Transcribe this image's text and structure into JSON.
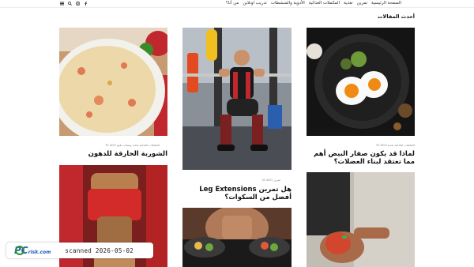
{
  "nav": {
    "items": [
      "الصفحة الرئيسية",
      "تمرين",
      "تغذية",
      "المكملات الغذائية",
      "الأدوية والمنشطات",
      "تدريب اونلاين",
      "من أنا؟"
    ],
    "icons": [
      "facebook-icon",
      "instagram-icon",
      "search-icon",
      "menu-icon"
    ]
  },
  "section": {
    "title": "أحدث المقالات"
  },
  "articles": [
    {
      "meta": "المكملات الغذائية  تغذية  وصفات طبخ  3Y AGO",
      "title": "الشوربة الحارقة للدهون"
    },
    {
      "meta": "المكملات الغذائية  تغذية  3Y AGO",
      "title": "لماذا قد يكون صفار البيض أهم مما تعتقد لبناء العضلات؟"
    },
    {
      "meta": "تمرين  3Y AGO",
      "title": "هل تمرين Leg Extensions أفضل من السكوات؟"
    }
  ],
  "watermark": {
    "brand": "PC",
    "brand_suffix": "risk.com",
    "text": "scanned 2026-05-02"
  },
  "colors": {
    "accent_red": "#c0282e",
    "badge_blue": "#1a5fb4"
  }
}
